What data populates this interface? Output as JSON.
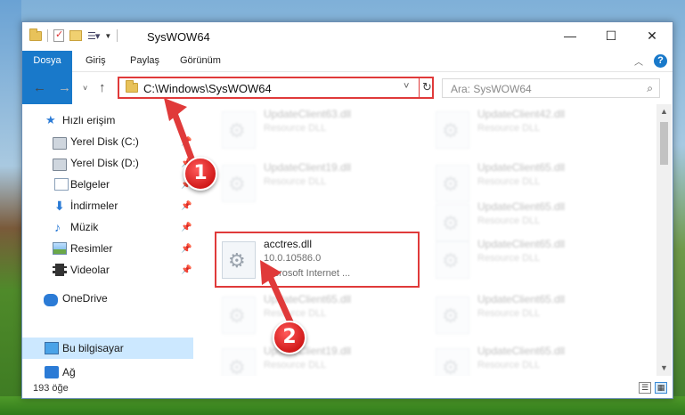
{
  "window": {
    "title": "SysWOW64",
    "controls": {
      "minimize": "—",
      "maximize": "☐",
      "close": "✕"
    }
  },
  "ribbon": {
    "tabs": [
      "Dosya",
      "Giriş",
      "Paylaş",
      "Görünüm"
    ],
    "help_label": "?"
  },
  "address_bar": {
    "path": "C:\\Windows\\SysWOW64",
    "search_placeholder": "Ara: SysWOW64"
  },
  "sidebar": {
    "items": [
      {
        "label": "Hızlı erişim",
        "icon": "star-icon",
        "pinned": false
      },
      {
        "label": "Yerel Disk (C:)",
        "icon": "disk-icon",
        "pinned": true
      },
      {
        "label": "Yerel Disk (D:)",
        "icon": "disk-icon",
        "pinned": true
      },
      {
        "label": "Belgeler",
        "icon": "document-icon",
        "pinned": true
      },
      {
        "label": "İndirmeler",
        "icon": "download-icon",
        "pinned": true
      },
      {
        "label": "Müzik",
        "icon": "music-icon",
        "pinned": true
      },
      {
        "label": "Resimler",
        "icon": "pictures-icon",
        "pinned": true
      },
      {
        "label": "Videolar",
        "icon": "video-icon",
        "pinned": true
      },
      {
        "label": "OneDrive",
        "icon": "cloud-icon",
        "pinned": false
      },
      {
        "label": "Bu bilgisayar",
        "icon": "computer-icon",
        "pinned": false,
        "selected": true
      },
      {
        "label": "Ağ",
        "icon": "network-icon",
        "pinned": false
      }
    ]
  },
  "files": {
    "selected": {
      "name": "acctres.dll",
      "version": "10.0.10586.0",
      "company": "Microsoft Internet ..."
    },
    "blurred": [
      {
        "name": "UpdateClient63.dll",
        "desc": "Resource DLL"
      },
      {
        "name": "UpdateClient42.dll",
        "desc": "Resource DLL"
      },
      {
        "name": "UpdateClient19.dll",
        "desc": "Resource DLL"
      },
      {
        "name": "UpdateClient65.dll",
        "desc": "Resource DLL"
      },
      {
        "name": "UpdateClient65.dll",
        "desc": "Resource DLL"
      },
      {
        "name": "UpdateClient65.dll",
        "desc": "Resource DLL"
      },
      {
        "name": "UpdateClient65.dll",
        "desc": "Resource DLL"
      },
      {
        "name": "UpdateClient65.dll",
        "desc": "Resource DLL"
      },
      {
        "name": "UpdateClient19.dll",
        "desc": "Resource DLL"
      },
      {
        "name": "UpdateClient65.dll",
        "desc": "Resource DLL"
      }
    ]
  },
  "status": {
    "item_count": "193 öğe"
  },
  "callouts": {
    "step1": "1",
    "step2": "2"
  },
  "colors": {
    "accent": "#1979ca",
    "highlight": "#e03a3a",
    "selected_bg": "#cce8ff"
  }
}
